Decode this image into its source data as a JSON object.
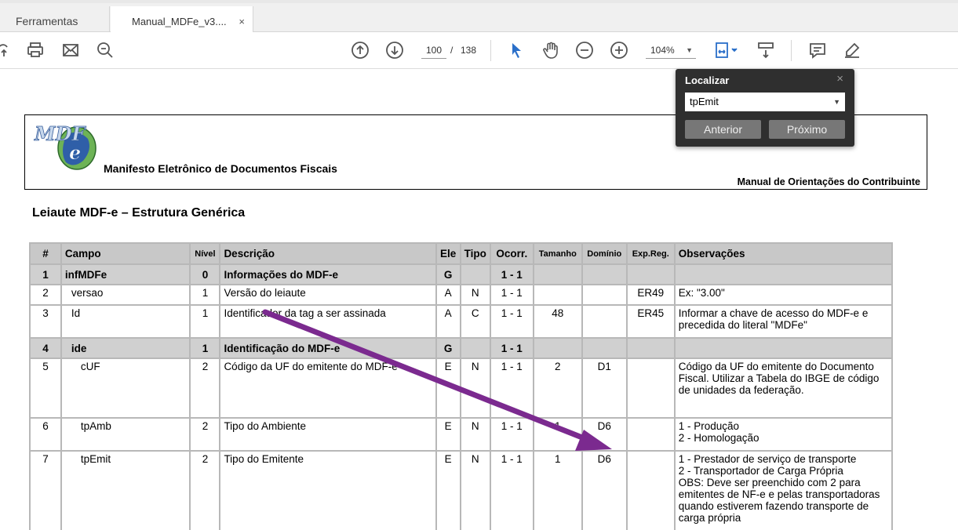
{
  "tabs": {
    "tools_label": "Ferramentas",
    "doc_label": "Manual_MDFe_v3....",
    "close_glyph": "×"
  },
  "toolbar": {
    "page_current": "100",
    "page_sep": "/",
    "page_total": "138",
    "zoom": "104%"
  },
  "finder": {
    "title": "Localizar",
    "close_glyph": "×",
    "query": "tpEmit",
    "prev_label": "Anterior",
    "next_label": "Próximo"
  },
  "document": {
    "header_title": "Manifesto Eletrônico de Documentos Fiscais",
    "header_right": "Manual de Orientações do Contribuinte",
    "section_title": "Leiaute MDF-e – Estrutura Genérica"
  },
  "table": {
    "headers": [
      "#",
      "Campo",
      "Nível",
      "Descrição",
      "Ele",
      "Tipo",
      "Ocorr.",
      "Tamanho",
      "Domínio",
      "Exp.Reg.",
      "Observações"
    ],
    "rows": [
      {
        "n": "1",
        "campo": "infMDFe",
        "nivel": "0",
        "desc": "Informações do MDF-e",
        "ele": "G",
        "tipo": "",
        "ocorr": "1 - 1",
        "tam": "",
        "dom": "",
        "exp": "",
        "obs": ""
      },
      {
        "n": "2",
        "campo": "versao",
        "nivel": "1",
        "desc": "Versão do leiaute",
        "ele": "A",
        "tipo": "N",
        "ocorr": "1 - 1",
        "tam": "",
        "dom": "",
        "exp": "ER49",
        "obs": "Ex: \"3.00\""
      },
      {
        "n": "3",
        "campo": "Id",
        "nivel": "1",
        "desc": "Identificador da tag a ser assinada",
        "ele": "A",
        "tipo": "C",
        "ocorr": "1 - 1",
        "tam": "48",
        "dom": "",
        "exp": "ER45",
        "obs": "Informar a chave de acesso do MDF-e e precedida do literal \"MDFe\""
      },
      {
        "n": "4",
        "campo": "ide",
        "nivel": "1",
        "desc": "Identificação do MDF-e",
        "ele": "G",
        "tipo": "",
        "ocorr": "1 - 1",
        "tam": "",
        "dom": "",
        "exp": "",
        "obs": ""
      },
      {
        "n": "5",
        "campo": "cUF",
        "nivel": "2",
        "desc": "Código da UF do emitente do MDF-e",
        "ele": "E",
        "tipo": "N",
        "ocorr": "1 - 1",
        "tam": "2",
        "dom": "D1",
        "exp": "",
        "obs": "Código da UF do emitente do Documento Fiscal. Utilizar a Tabela do IBGE de código de unidades da federação."
      },
      {
        "n": "6",
        "campo": "tpAmb",
        "nivel": "2",
        "desc": "Tipo do Ambiente",
        "ele": "E",
        "tipo": "N",
        "ocorr": "1 - 1",
        "tam": "1",
        "dom": "D6",
        "exp": "",
        "obs_lines": [
          "1 - Produção",
          "2 - Homologação"
        ]
      },
      {
        "n": "7",
        "campo": "tpEmit",
        "nivel": "2",
        "desc": "Tipo do Emitente",
        "ele": "E",
        "tipo": "N",
        "ocorr": "1 - 1",
        "tam": "1",
        "dom": "D6",
        "exp": "",
        "obs_lines": [
          "1 - Prestador de serviço de transporte",
          "2 - Transportador de Carga Própria",
          "OBS: Deve ser preenchido com 2 para emitentes de NF-e e pelas transportadoras quando estiverem fazendo transporte de carga própria"
        ]
      }
    ]
  },
  "colors": {
    "arrow": "#7b2a8f",
    "finder_bg": "#2f2f2f",
    "toolbar_blue": "#2a6fc9"
  }
}
